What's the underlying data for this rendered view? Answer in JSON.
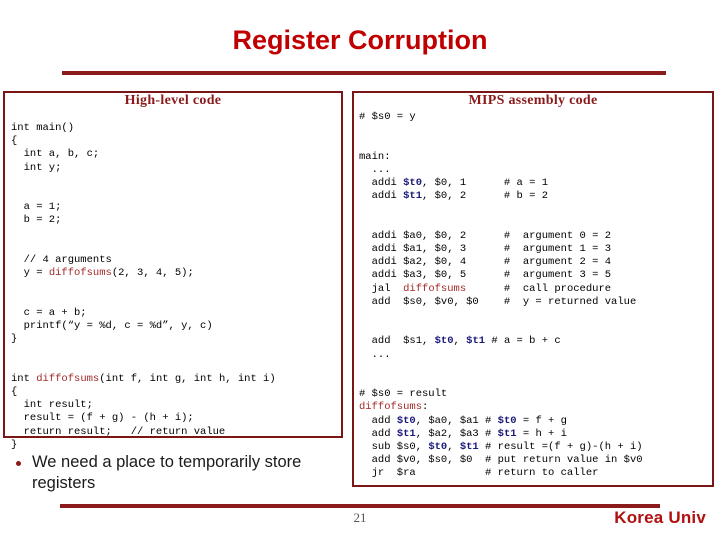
{
  "slide": {
    "title": "Register Corruption",
    "page_number": "21",
    "brand": "Korea Univ",
    "accent_color": "#8B1A1A",
    "title_color": "#C00000",
    "code_keyword_color": "#A52A2A",
    "register_highlight_color": "#1A1A7A"
  },
  "left_panel": {
    "heading": "High-level code",
    "code_lines": [
      "int main()",
      "{",
      "  int a, b, c;",
      "  int y;",
      "",
      "  a = 1;",
      "  b = 2;",
      "",
      "  // 4 arguments",
      "  y = diffofsums(2, 3, 4, 5);",
      "",
      "  c = a + b;",
      "  printf(“y = %d, c = %d”, y, c)",
      "}",
      "",
      "int diffofsums(int f, int g, int h, int i)",
      "{",
      "  int result;",
      "  result = (f + g) - (h + i);",
      "  return result;   // return value",
      "}"
    ]
  },
  "right_panel": {
    "heading": "MIPS assembly code",
    "code_lines": [
      "# $s0 = y",
      "",
      "main:",
      "  ...",
      "  addi $t0, $0, 1      # a = 1",
      "  addi $t1, $0, 2      # b = 2",
      "",
      "  addi $a0, $0, 2      #  argument 0 = 2",
      "  addi $a1, $0, 3      #  argument 1 = 3",
      "  addi $a2, $0, 4      #  argument 2 = 4",
      "  addi $a3, $0, 5      #  argument 3 = 5",
      "  jal  diffofsums      #  call procedure",
      "  add  $s0, $v0, $0    #  y = returned value",
      "",
      "  add  $s1, $t0, $t1 # a = b + c",
      "  ...",
      "",
      "# $s0 = result",
      "diffofsums:",
      "  add $t0, $a0, $a1 # $t0 = f + g",
      "  add $t1, $a2, $a3 # $t1 = h + i",
      "  sub $s0, $t0, $t1 # result =(f + g)-(h + i)",
      "  add $v0, $s0, $0  # put return value in $v0",
      "  jr  $ra           # return to caller"
    ]
  },
  "bullets": [
    "We need a place to temporarily store registers"
  ]
}
